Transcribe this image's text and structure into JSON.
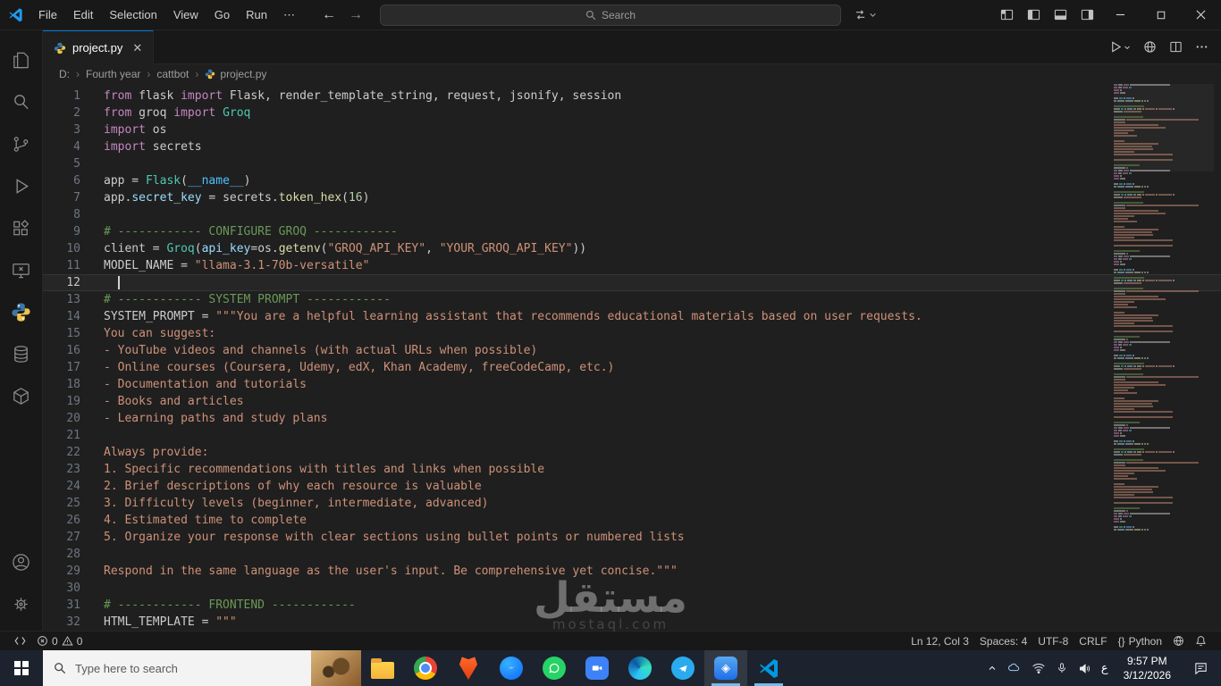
{
  "palette": {
    "d": "#cccccc",
    "k": "#c586c0",
    "s": "#ce9178",
    "c": "#6a9955",
    "f": "#dcdcaa",
    "cl": "#4ec9b0",
    "v": "#9cdcfe",
    "n": "#b5cea8",
    "ct": "#4fc1ff"
  },
  "title_bar": {
    "menus": [
      "File",
      "Edit",
      "Selection",
      "View",
      "Go",
      "Run",
      "⋯"
    ],
    "search_placeholder": "Search"
  },
  "tab": {
    "label": "project.py"
  },
  "breadcrumb": {
    "drive": "D:",
    "folder1": "Fourth year",
    "folder2": "cattbot",
    "file": "project.py"
  },
  "editor": {
    "cursor": {
      "line": 12,
      "col": 3
    },
    "lines": [
      {
        "n": 1,
        "s": [
          [
            "k",
            "from "
          ],
          [
            "d",
            "flask "
          ],
          [
            "k",
            "import "
          ],
          [
            "d",
            "Flask, render_template_string, request, jsonify, session"
          ]
        ]
      },
      {
        "n": 2,
        "s": [
          [
            "k",
            "from "
          ],
          [
            "d",
            "groq "
          ],
          [
            "k",
            "import "
          ],
          [
            "cl",
            "Groq"
          ]
        ]
      },
      {
        "n": 3,
        "s": [
          [
            "k",
            "import "
          ],
          [
            "d",
            "os"
          ]
        ]
      },
      {
        "n": 4,
        "s": [
          [
            "k",
            "import "
          ],
          [
            "d",
            "secrets"
          ]
        ]
      },
      {
        "n": 5,
        "s": []
      },
      {
        "n": 6,
        "s": [
          [
            "d",
            "app = "
          ],
          [
            "cl",
            "Flask"
          ],
          [
            "d",
            "("
          ],
          [
            "ct",
            "__name__"
          ],
          [
            "d",
            ")"
          ]
        ]
      },
      {
        "n": 7,
        "s": [
          [
            "d",
            "app."
          ],
          [
            "v",
            "secret_key"
          ],
          [
            "d",
            " = secrets."
          ],
          [
            "f",
            "token_hex"
          ],
          [
            "d",
            "("
          ],
          [
            "n",
            "16"
          ],
          [
            "d",
            ")"
          ]
        ]
      },
      {
        "n": 8,
        "s": []
      },
      {
        "n": 9,
        "s": [
          [
            "c",
            "# ------------ CONFIGURE GROQ ------------"
          ]
        ]
      },
      {
        "n": 10,
        "s": [
          [
            "d",
            "client = "
          ],
          [
            "cl",
            "Groq"
          ],
          [
            "d",
            "("
          ],
          [
            "v",
            "api_key"
          ],
          [
            "d",
            "=os."
          ],
          [
            "f",
            "getenv"
          ],
          [
            "d",
            "("
          ],
          [
            "s",
            "\"GROQ_API_KEY\""
          ],
          [
            "d",
            ", "
          ],
          [
            "s",
            "\"YOUR_GROQ_API_KEY\""
          ],
          [
            "d",
            "))"
          ]
        ]
      },
      {
        "n": 11,
        "s": [
          [
            "d",
            "MODEL_NAME = "
          ],
          [
            "s",
            "\"llama-3.1-70b-versatile\""
          ]
        ]
      },
      {
        "n": 12,
        "s": []
      },
      {
        "n": 13,
        "s": [
          [
            "c",
            "# ------------ SYSTEM PROMPT ------------"
          ]
        ]
      },
      {
        "n": 14,
        "s": [
          [
            "d",
            "SYSTEM_PROMPT = "
          ],
          [
            "s",
            "\"\"\"You are a helpful learning assistant that recommends educational materials based on user requests."
          ]
        ]
      },
      {
        "n": 15,
        "s": [
          [
            "s",
            "You can suggest:"
          ]
        ]
      },
      {
        "n": 16,
        "s": [
          [
            "s",
            "- YouTube videos and channels (with actual URLs when possible)"
          ]
        ]
      },
      {
        "n": 17,
        "s": [
          [
            "s",
            "- Online courses (Coursera, Udemy, edX, Khan Academy, freeCodeCamp, etc.)"
          ]
        ]
      },
      {
        "n": 18,
        "s": [
          [
            "s",
            "- Documentation and tutorials"
          ]
        ]
      },
      {
        "n": 19,
        "s": [
          [
            "s",
            "- Books and articles"
          ]
        ]
      },
      {
        "n": 20,
        "s": [
          [
            "s",
            "- Learning paths and study plans"
          ]
        ]
      },
      {
        "n": 21,
        "s": []
      },
      {
        "n": 22,
        "s": [
          [
            "s",
            "Always provide:"
          ]
        ]
      },
      {
        "n": 23,
        "s": [
          [
            "s",
            "1. Specific recommendations with titles and links when possible"
          ]
        ]
      },
      {
        "n": 24,
        "s": [
          [
            "s",
            "2. Brief descriptions of why each resource is valuable"
          ]
        ]
      },
      {
        "n": 25,
        "s": [
          [
            "s",
            "3. Difficulty levels (beginner, intermediate, advanced)"
          ]
        ]
      },
      {
        "n": 26,
        "s": [
          [
            "s",
            "4. Estimated time to complete"
          ]
        ]
      },
      {
        "n": 27,
        "s": [
          [
            "s",
            "5. Organize your response with clear sections using bullet points or numbered lists"
          ]
        ]
      },
      {
        "n": 28,
        "s": []
      },
      {
        "n": 29,
        "s": [
          [
            "s",
            "Respond in the same language as the user's input. Be comprehensive yet concise.\"\"\""
          ]
        ]
      },
      {
        "n": 30,
        "s": []
      },
      {
        "n": 31,
        "s": [
          [
            "c",
            "# ------------ FRONTEND ------------"
          ]
        ]
      },
      {
        "n": 32,
        "s": [
          [
            "d",
            "HTML_TEMPLATE = "
          ],
          [
            "s",
            "\"\"\""
          ]
        ]
      }
    ]
  },
  "status_bar": {
    "errors": "0",
    "warnings": "0",
    "cursor_position": "Ln 12, Col 3",
    "indentation": "Spaces: 4",
    "encoding": "UTF-8",
    "eol": "CRLF",
    "braces_glyph": "{}",
    "language": "Python"
  },
  "taskbar": {
    "search_placeholder": "Type here to search",
    "zoom_label": "zm",
    "language": "ع",
    "time": "9:57 PM",
    "date": "3/12/2026"
  },
  "watermark": {
    "title": "مستقل",
    "subtitle": "mostaql.com"
  }
}
